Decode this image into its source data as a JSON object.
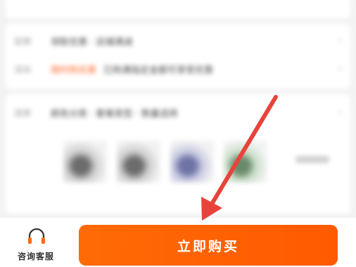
{
  "sections": {
    "promo": {
      "rows": [
        {
          "label": "促销",
          "text": "领取优惠 · 店铺满减",
          "chevron": "›"
        },
        {
          "label": "活动",
          "promo": "限时购优惠",
          "text": "已购满指定金额可享受优惠",
          "chevron": "›"
        }
      ]
    },
    "spec": {
      "row": {
        "label": "选择",
        "text": "颜色分类 · 套餐类型 · 数量选择",
        "chevron": "›"
      },
      "thumbnails": [
        "scooter-thumbnail-1",
        "scooter-thumbnail-2",
        "scooter-thumbnail-3",
        "scooter-thumbnail-4"
      ]
    }
  },
  "bottom_bar": {
    "service": {
      "label": "咨询客服",
      "icon": "headset-icon"
    },
    "buy_button": {
      "label": "立即购买"
    }
  },
  "colors": {
    "accent": "#ff6a06",
    "arrow": "#e8433a"
  }
}
